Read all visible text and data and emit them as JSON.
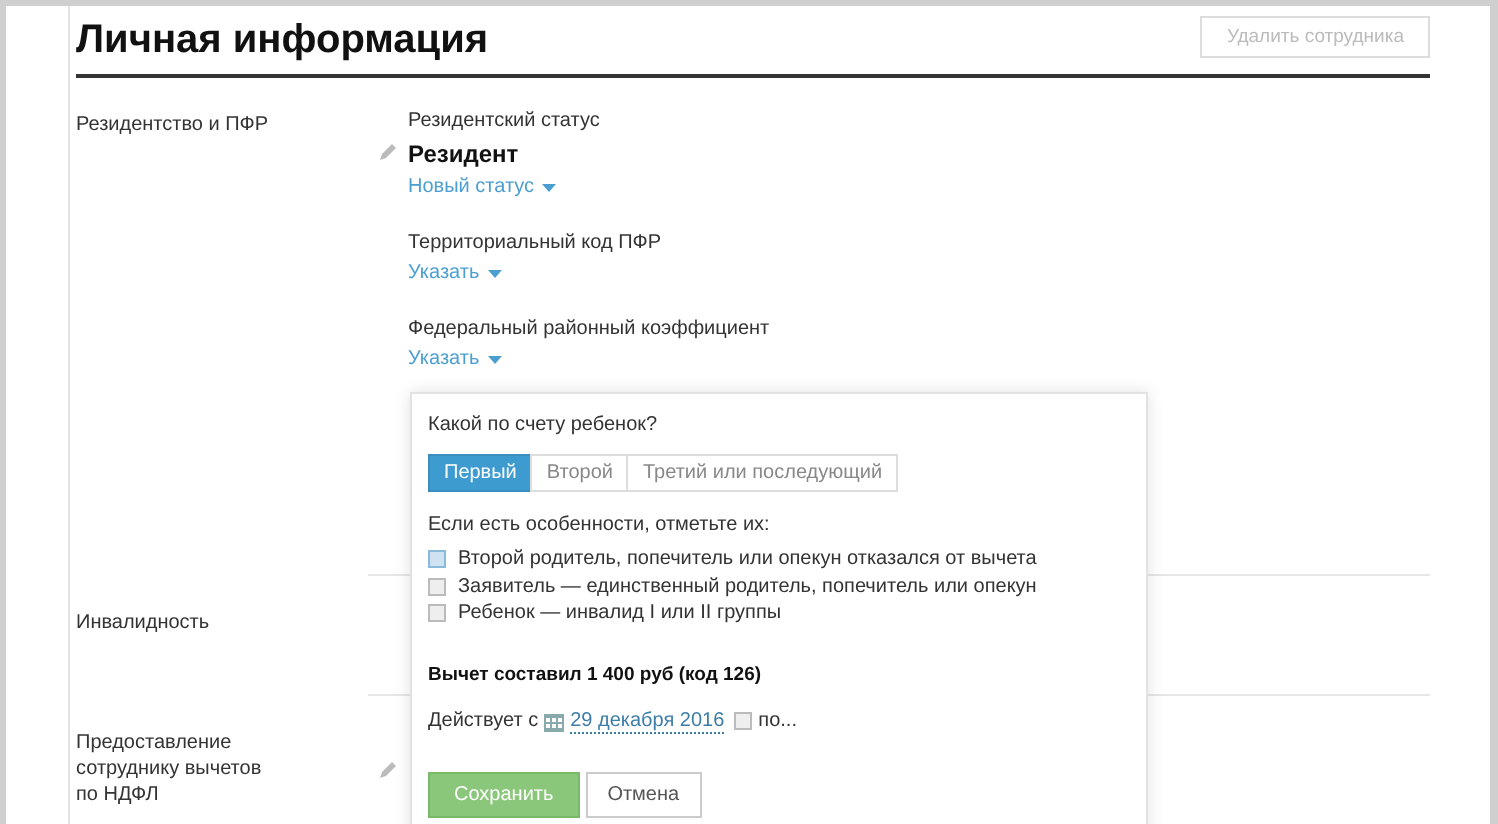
{
  "title": "Личная информация",
  "delete_button": {
    "label": "Удалить сотрудника",
    "disabled": true
  },
  "sections": [
    {
      "label": "Резидентство и ПФР",
      "kind": "fields",
      "fields": [
        {
          "label": "Резидентский статус",
          "value": "Резидент",
          "link": "Новый статус"
        },
        {
          "label": "Территориальный код ПФР",
          "link": "Указать"
        },
        {
          "label": "Федеральный районный коэффициент",
          "link": "Указать"
        }
      ]
    },
    {
      "label": "Инвалидность",
      "kind": "empty"
    },
    {
      "label": "Предоставление сотруднику вычетов по НДФЛ",
      "kind": "empty"
    }
  ],
  "popup": {
    "question": "Какой по счету ребенок?",
    "tabs": [
      {
        "label": "Первый",
        "selected": true
      },
      {
        "label": "Второй",
        "selected": false
      },
      {
        "label": "Третий или последующий",
        "selected": false
      }
    ],
    "hint": "Если есть особенности, отметьте их:",
    "options": [
      {
        "label": "Второй родитель, попечитель или опекун отказался от вычета",
        "checked": false,
        "hovered": true
      },
      {
        "label": "Заявитель — единственный родитель, попечитель или опекун",
        "checked": false,
        "hovered": false
      },
      {
        "label": "Ребенок — инвалид I или II группы",
        "checked": false,
        "hovered": false
      }
    ],
    "result": "Вычет составил 1 400 руб (код 126)",
    "valid_from_label": "Действует с",
    "date": "29 декабря 2016",
    "until_checked": false,
    "until_label": "по...",
    "save": "Сохранить",
    "cancel": "Отмена"
  }
}
